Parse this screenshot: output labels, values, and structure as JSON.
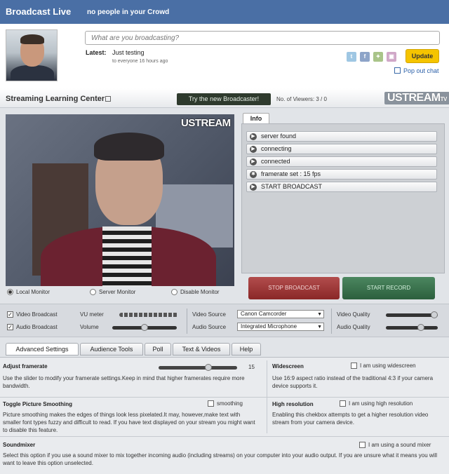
{
  "header": {
    "title": "Broadcast Live",
    "subtitle": "no people in your Crowd"
  },
  "status": {
    "placeholder": "What are you broadcasting?",
    "latest_label": "Latest:",
    "latest_value": "Just testing",
    "latest_meta": "to everyone 16 hours ago",
    "update_label": "Update",
    "popout_label": "Pop out chat",
    "social_icons": [
      "twitter-icon",
      "facebook-icon",
      "myspace-icon",
      "other-icon"
    ]
  },
  "studio": {
    "title": "Streaming Learning Center",
    "try_button": "Try the new Broadcaster!",
    "viewers": "No. of Viewers: 3 / 0",
    "logo": "USTREAM",
    "logo_suffix": "TV",
    "video_logo": "USTREAM",
    "monitors": [
      {
        "label": "Local Monitor",
        "selected": true
      },
      {
        "label": "Server Monitor",
        "selected": false
      },
      {
        "label": "Disable Monitor",
        "selected": false
      }
    ]
  },
  "info": {
    "tab": "Info",
    "items": [
      {
        "text": "server found",
        "icon": "play-icon"
      },
      {
        "text": "connecting",
        "icon": "play-icon"
      },
      {
        "text": "connected",
        "icon": "play-icon"
      },
      {
        "text": "framerate set : 15 fps",
        "icon": "gear-icon"
      },
      {
        "text": "START BROADCAST",
        "icon": "play-icon"
      }
    ],
    "stop_button": "STOP BROADCAST",
    "record_button": "START RECORD"
  },
  "controls": {
    "video_broadcast": "Video Broadcast",
    "audio_broadcast": "Audio Broadcast",
    "video_checked": true,
    "audio_checked": true,
    "vu_label": "VU meter",
    "volume_label": "Volume",
    "volume_level": 0.5,
    "video_source_label": "Video Source",
    "video_source_value": "Canon Camcorder",
    "audio_source_label": "Audio Source",
    "audio_source_value": "Integrated Microphone",
    "video_quality_label": "Video Quality",
    "audio_quality_label": "Audio Quality",
    "video_quality_level": 1.0,
    "audio_quality_level": 0.7
  },
  "tabs": [
    "Advanced Settings",
    "Audience Tools",
    "Poll",
    "Text & Videos",
    "Help"
  ],
  "settings": {
    "framerate": {
      "title": "Adjust framerate",
      "value": "15",
      "level": 0.65,
      "desc": "Use the slider to modify your framerate settings.Keep in mind that higher framerates require more bandwidth."
    },
    "widescreen": {
      "title": "Widescreen",
      "check_label": "I am using widescreen",
      "desc": "Use 16:9 aspect ratio instead of the traditional 4:3 if your camera device supports it."
    },
    "smoothing": {
      "title": "Toggle Picture Smoothing",
      "check_label": "smoothing",
      "desc": "Picture smoothing makes the edges of things look less pixelated.It may, however,make text with smaller font types fuzzy and difficult to read. If you have text displayed on your stream you might want to disable this feature."
    },
    "highres": {
      "title": "High resolution",
      "check_label": "I am using high resolution",
      "desc": "Enabling this chekbox attempts to get a higher resolution video stream from your camera device."
    },
    "soundmixer": {
      "title": "Soundmixer",
      "check_label": "I am using a sound mixer",
      "desc": "Select this option if you use a sound mixer to mix together incoming audio (including streams) on your computer into your audio output. If you are unsure what it means you will want to leave this option unselected."
    }
  }
}
